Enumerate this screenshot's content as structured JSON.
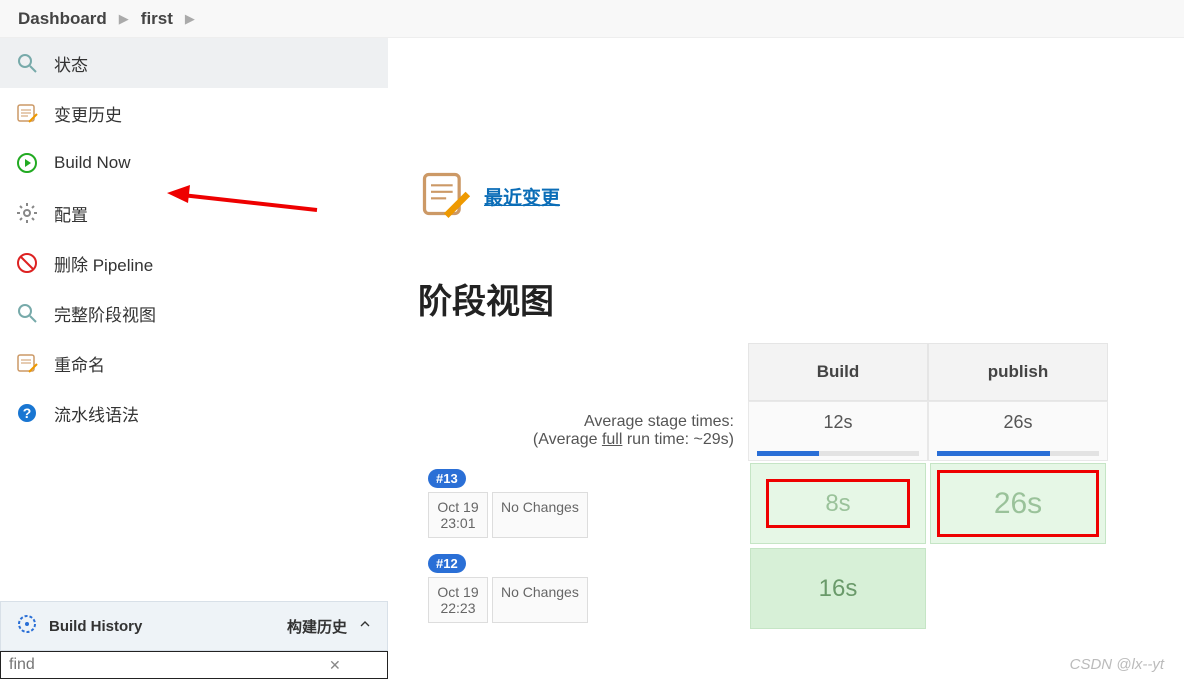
{
  "breadcrumb": {
    "root": "Dashboard",
    "job": "first"
  },
  "sidebar": {
    "items": [
      {
        "label": "状态"
      },
      {
        "label": "变更历史"
      },
      {
        "label": "Build Now"
      },
      {
        "label": "配置"
      },
      {
        "label": "删除 Pipeline"
      },
      {
        "label": "完整阶段视图"
      },
      {
        "label": "重命名"
      },
      {
        "label": "流水线语法"
      }
    ],
    "build_history_title": "Build History",
    "build_history_cn": "构建历史",
    "filter_placeholder": "find"
  },
  "main": {
    "recent_changes_label": "最近变更",
    "stage_view_title": "阶段视图",
    "avg_line1": "Average stage times:",
    "avg_line2_prefix": "(Average ",
    "avg_line2_full": "full",
    "avg_line2_suffix": " run time: ~29s)",
    "columns": [
      {
        "name": "Build",
        "avg": "12s",
        "bar_pct": 38
      },
      {
        "name": "publish",
        "avg": "26s",
        "bar_pct": 70
      }
    ],
    "rows": [
      {
        "id": "#13",
        "date": "Oct 19",
        "time": "23:01",
        "changes": "No Changes",
        "stages": [
          "8s",
          "26s"
        ],
        "hl": [
          true,
          true
        ]
      },
      {
        "id": "#12",
        "date": "Oct 19",
        "time": "22:23",
        "changes": "No Changes",
        "stages": [
          "16s",
          ""
        ],
        "hl": [
          false,
          false
        ]
      }
    ]
  },
  "watermark": "CSDN @lx--yt"
}
